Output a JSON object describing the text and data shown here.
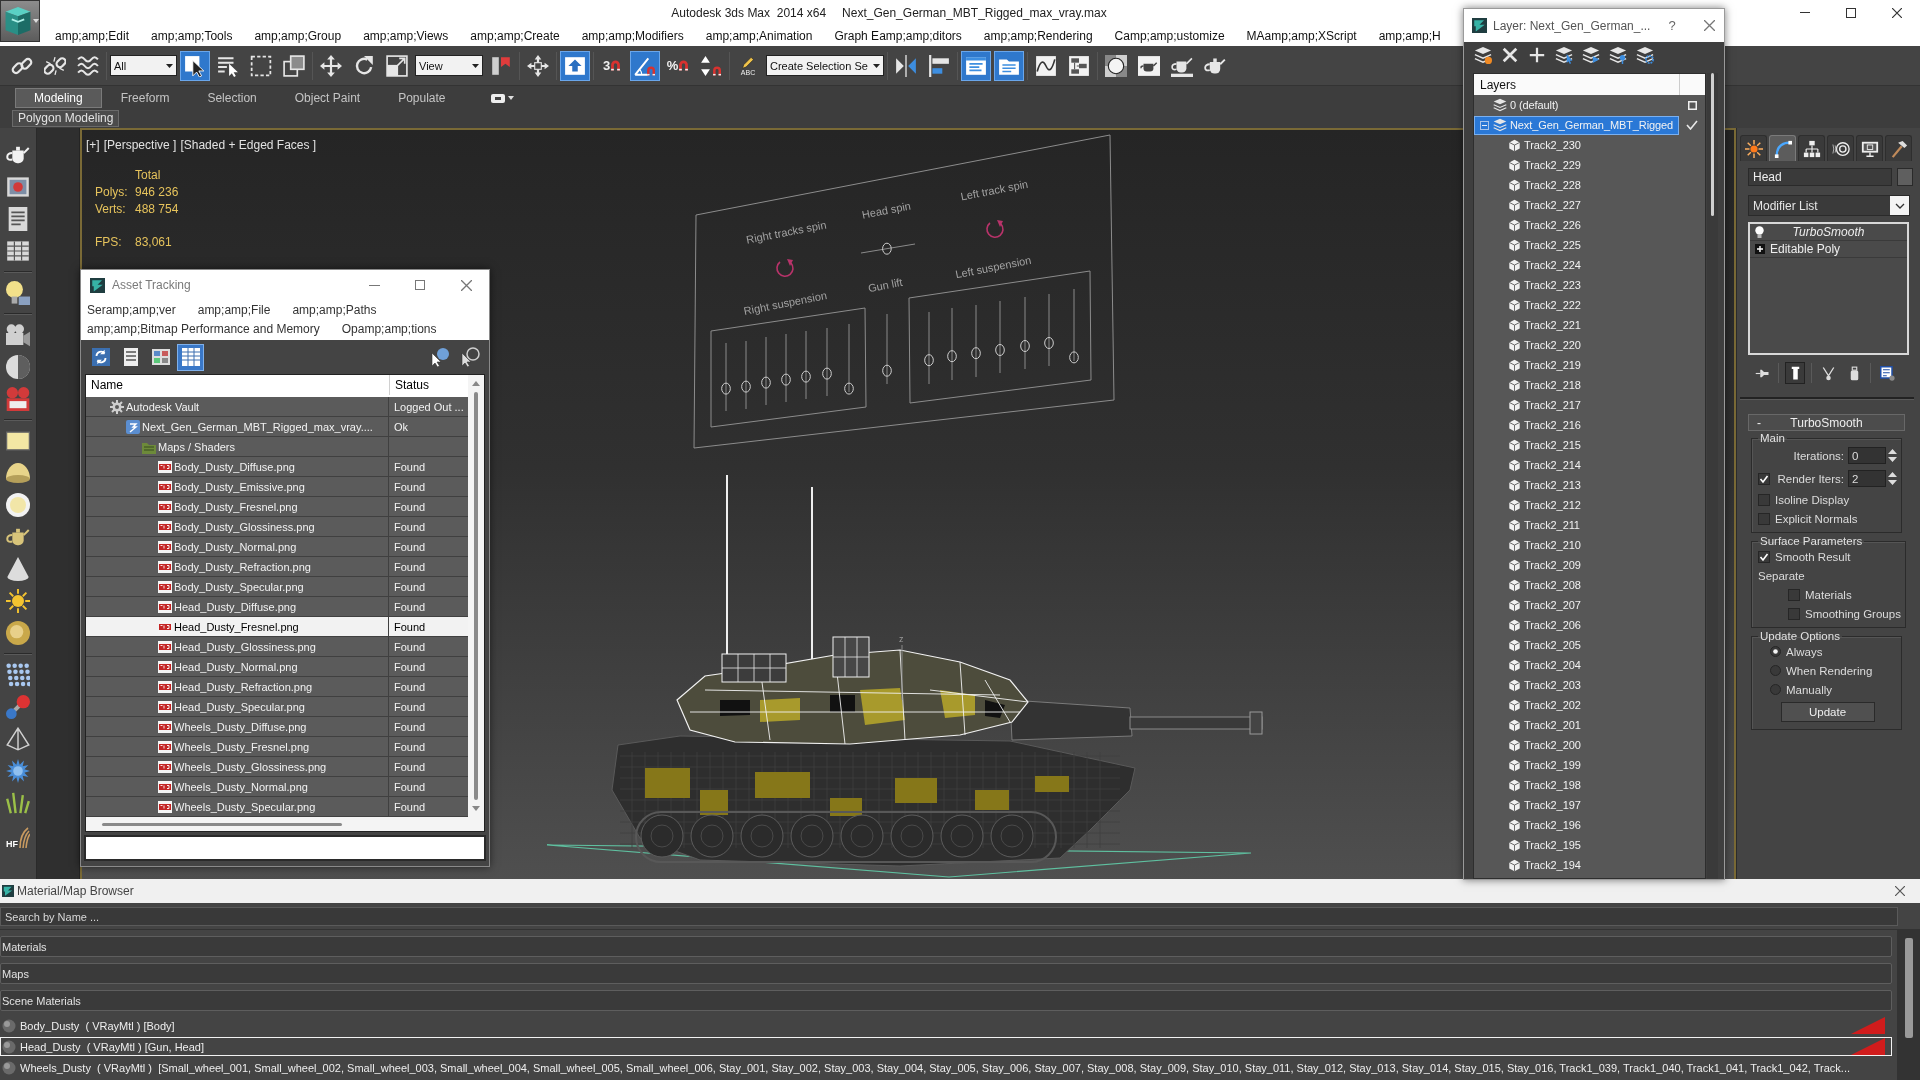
{
  "title_bar": {
    "app": "Autodesk 3ds Max  2014 x64",
    "file": "Next_Gen_German_MBT_Rigged_max_vray.max"
  },
  "menu": [
    "amp;amp;Edit",
    "amp;amp;Tools",
    "amp;amp;Group",
    "amp;amp;Views",
    "amp;amp;Create",
    "amp;amp;Modifiers",
    "amp;amp;Animation",
    "Graph Eamp;amp;ditors",
    "amp;amp;Rendering",
    "Camp;amp;ustomize",
    "MAamp;amp;XScript",
    "amp;amp;H"
  ],
  "toolbar": [
    [
      {
        "kind": "link",
        "on": false
      },
      {
        "kind": "unlink",
        "on": false
      },
      {
        "kind": "bind",
        "on": false
      }
    ],
    [
      {
        "kind": "filter-dropdown",
        "value": "All"
      },
      {
        "kind": "select",
        "on": true
      },
      {
        "kind": "select-by-name",
        "on": false
      },
      {
        "kind": "region",
        "on": false
      },
      {
        "kind": "crossing",
        "on": false
      }
    ],
    [
      {
        "kind": "move",
        "on": false
      },
      {
        "kind": "rotate",
        "on": false
      },
      {
        "kind": "scale",
        "on": false
      },
      {
        "kind": "coordinate-dropdown",
        "value": "View"
      },
      {
        "kind": "pivot",
        "on": false
      }
    ],
    [
      {
        "kind": "manipulate",
        "on": false
      }
    ],
    [
      {
        "kind": "keyboard",
        "on": true
      }
    ],
    [
      {
        "kind": "snap",
        "label": "3",
        "on": false
      },
      {
        "kind": "angle-snap",
        "on": true
      },
      {
        "kind": "percent-snap",
        "label": "%",
        "on": false
      },
      {
        "kind": "spinner-snap",
        "on": false
      }
    ],
    [
      {
        "kind": "named-selection",
        "label": "ABC",
        "on": false
      },
      {
        "kind": "selection-set-dropdown",
        "value": "Create Selection Se"
      }
    ],
    [
      {
        "kind": "mirror",
        "on": false
      },
      {
        "kind": "align",
        "on": false
      }
    ],
    [
      {
        "kind": "scene-explorer",
        "on": true
      },
      {
        "kind": "layer-manager",
        "on": true
      }
    ],
    [
      {
        "kind": "curve-editor",
        "on": false
      },
      {
        "kind": "schematic",
        "on": false
      }
    ],
    [
      {
        "kind": "material-editor",
        "on": false
      },
      {
        "kind": "render-setup",
        "on": false
      },
      {
        "kind": "frame-window",
        "on": false
      },
      {
        "kind": "render",
        "on": false
      }
    ]
  ],
  "ribbon": {
    "tabs": [
      {
        "label": "Modeling",
        "selected": true
      },
      {
        "label": "Freeform",
        "selected": false
      },
      {
        "label": "Selection",
        "selected": false
      },
      {
        "label": "Object Paint",
        "selected": false
      },
      {
        "label": "Populate",
        "selected": false
      }
    ],
    "panel": "Polygon Modeling"
  },
  "left_toolbar": {
    "hair_label": "HF"
  },
  "viewport": {
    "menus": [
      "[+]",
      "[Perspective ]",
      "[Shaded + Edged Faces ]"
    ],
    "stats_heading": "Total",
    "stats": [
      {
        "label": "Polys:",
        "value": "946 236"
      },
      {
        "label": "Verts:",
        "value": "488 754"
      }
    ],
    "fps": {
      "label": "FPS:",
      "value": "83,061"
    },
    "rig_labels": [
      "Right tracks spin",
      "Head spin",
      "Left track spin",
      "Right suspension",
      "Gun lift",
      "Left suspension"
    ],
    "rig_sliders": [
      {
        "level": 0.33
      },
      {
        "level": 0.33
      },
      {
        "level": 0.33
      },
      {
        "level": 0.33
      },
      {
        "level": 0.33
      },
      {
        "level": 0.33
      },
      {
        "level": 0.05
      },
      {
        "level": 0.33
      },
      {
        "level": 0.33
      },
      {
        "level": 0.33
      },
      {
        "level": 0.32
      },
      {
        "level": 0.32
      },
      {
        "level": 0.32
      },
      {
        "level": 0.05
      },
      {
        "level": 0.19
      },
      {
        "level": 0.48
      }
    ],
    "axis_label": "z"
  },
  "asset_tracking": {
    "title": "Asset Tracking",
    "menu_rows": [
      [
        "Seramp;amp;ver",
        "amp;amp;File",
        "amp;amp;Paths"
      ],
      [
        "amp;amp;Bitmap Performance and Memory",
        "Opamp;amp;tions"
      ]
    ],
    "toolbar": [
      {
        "kind": "refresh",
        "on": false
      },
      {
        "kind": "list",
        "on": false
      },
      {
        "kind": "thumbnails",
        "on": false
      },
      {
        "kind": "table",
        "on": true
      }
    ],
    "columns": [
      "Name",
      "Status"
    ],
    "tree": [
      {
        "kind": "vault",
        "name": "Autodesk Vault",
        "status": "Logged Out ...",
        "selected": false,
        "children": [
          {
            "kind": "max-file",
            "name": "Next_Gen_German_MBT_Rigged_max_vray....",
            "status": "Ok",
            "selected": false,
            "children": [
              {
                "kind": "folder",
                "name": "Maps / Shaders",
                "selected": false,
                "children": [
                  {
                    "kind": "png",
                    "name": "Body_Dusty_Diffuse.png",
                    "status": "Found",
                    "selected": false
                  },
                  {
                    "kind": "png",
                    "name": "Body_Dusty_Emissive.png",
                    "status": "Found",
                    "selected": false
                  },
                  {
                    "kind": "png",
                    "name": "Body_Dusty_Fresnel.png",
                    "status": "Found",
                    "selected": false
                  },
                  {
                    "kind": "png",
                    "name": "Body_Dusty_Glossiness.png",
                    "status": "Found",
                    "selected": false
                  },
                  {
                    "kind": "png",
                    "name": "Body_Dusty_Normal.png",
                    "status": "Found",
                    "selected": false
                  },
                  {
                    "kind": "png",
                    "name": "Body_Dusty_Refraction.png",
                    "status": "Found",
                    "selected": false
                  },
                  {
                    "kind": "png",
                    "name": "Body_Dusty_Specular.png",
                    "status": "Found",
                    "selected": false
                  },
                  {
                    "kind": "png",
                    "name": "Head_Dusty_Diffuse.png",
                    "status": "Found",
                    "selected": false
                  },
                  {
                    "kind": "png",
                    "name": "Head_Dusty_Fresnel.png",
                    "status": "Found",
                    "selected": true
                  },
                  {
                    "kind": "png",
                    "name": "Head_Dusty_Glossiness.png",
                    "status": "Found",
                    "selected": false
                  },
                  {
                    "kind": "png",
                    "name": "Head_Dusty_Normal.png",
                    "status": "Found",
                    "selected": false
                  },
                  {
                    "kind": "png",
                    "name": "Head_Dusty_Refraction.png",
                    "status": "Found",
                    "selected": false
                  },
                  {
                    "kind": "png",
                    "name": "Head_Dusty_Specular.png",
                    "status": "Found",
                    "selected": false
                  },
                  {
                    "kind": "png",
                    "name": "Wheels_Dusty_Diffuse.png",
                    "status": "Found",
                    "selected": false
                  },
                  {
                    "kind": "png",
                    "name": "Wheels_Dusty_Fresnel.png",
                    "status": "Found",
                    "selected": false
                  },
                  {
                    "kind": "png",
                    "name": "Wheels_Dusty_Glossiness.png",
                    "status": "Found",
                    "selected": false
                  },
                  {
                    "kind": "png",
                    "name": "Wheels_Dusty_Normal.png",
                    "status": "Found",
                    "selected": false
                  },
                  {
                    "kind": "png",
                    "name": "Wheels_Dusty_Specular.png",
                    "status": "Found",
                    "selected": false
                  }
                ]
              }
            ]
          }
        ]
      }
    ]
  },
  "layer_window": {
    "title": "Layer: Next_Gen_German_...",
    "help": "?",
    "header": "Layers",
    "layers": [
      {
        "name": "0 (default)",
        "current": false,
        "selected": false
      },
      {
        "name": "Next_Gen_German_MBT_Rigged",
        "current": true,
        "selected": true,
        "expanded": true,
        "children": [
          {
            "name": "Track2_230",
            "selected": false
          },
          {
            "name": "Track2_229",
            "selected": false
          },
          {
            "name": "Track2_228",
            "selected": false
          },
          {
            "name": "Track2_227",
            "selected": false
          },
          {
            "name": "Track2_226",
            "selected": false
          },
          {
            "name": "Track2_225",
            "selected": false
          },
          {
            "name": "Track2_224",
            "selected": false
          },
          {
            "name": "Track2_223",
            "selected": false
          },
          {
            "name": "Track2_222",
            "selected": false
          },
          {
            "name": "Track2_221",
            "selected": false
          },
          {
            "name": "Track2_220",
            "selected": false
          },
          {
            "name": "Track2_219",
            "selected": false
          },
          {
            "name": "Track2_218",
            "selected": false
          },
          {
            "name": "Track2_217",
            "selected": false
          },
          {
            "name": "Track2_216",
            "selected": false
          },
          {
            "name": "Track2_215",
            "selected": false
          },
          {
            "name": "Track2_214",
            "selected": false
          },
          {
            "name": "Track2_213",
            "selected": false
          },
          {
            "name": "Track2_212",
            "selected": false
          },
          {
            "name": "Track2_211",
            "selected": false
          },
          {
            "name": "Track2_210",
            "selected": false
          },
          {
            "name": "Track2_209",
            "selected": false
          },
          {
            "name": "Track2_208",
            "selected": false
          },
          {
            "name": "Track2_207",
            "selected": false
          },
          {
            "name": "Track2_206",
            "selected": false
          },
          {
            "name": "Track2_205",
            "selected": false
          },
          {
            "name": "Track2_204",
            "selected": false
          },
          {
            "name": "Track2_203",
            "selected": false
          },
          {
            "name": "Track2_202",
            "selected": false
          },
          {
            "name": "Track2_201",
            "selected": false
          },
          {
            "name": "Track2_200",
            "selected": false
          },
          {
            "name": "Track2_199",
            "selected": false
          },
          {
            "name": "Track2_198",
            "selected": false
          },
          {
            "name": "Track2_197",
            "selected": false
          },
          {
            "name": "Track2_196",
            "selected": false
          },
          {
            "name": "Track2_195",
            "selected": false
          },
          {
            "name": "Track2_194",
            "selected": false
          }
        ]
      }
    ]
  },
  "command_panel": {
    "tabs": [
      {
        "kind": "create",
        "selected": false
      },
      {
        "kind": "modify",
        "selected": true
      },
      {
        "kind": "hierarchy",
        "selected": false
      },
      {
        "kind": "motion",
        "selected": false
      },
      {
        "kind": "display",
        "selected": false
      },
      {
        "kind": "utilities",
        "selected": false
      }
    ],
    "object_name": "Head",
    "modifier_list": "Modifier List",
    "stack": [
      {
        "kind": "modifier",
        "name": "TurboSmooth",
        "on": true,
        "instanced": true
      },
      {
        "kind": "base-object",
        "name": "Editable Poly",
        "expanded": false,
        "instanced": false
      }
    ],
    "stack_buttons": [
      {
        "kind": "pin",
        "on": false
      },
      {
        "kind": "show-end-result",
        "on": true
      },
      {
        "kind": "make-unique",
        "on": false
      },
      {
        "kind": "remove",
        "on": false
      },
      {
        "kind": "configure",
        "on": false
      }
    ],
    "rollout": {
      "title": "TurboSmooth",
      "toggle": "-",
      "groups": [
        {
          "legend": "Main",
          "controls": [
            {
              "kind": "spinner",
              "label": "Iterations:",
              "value": "0"
            },
            {
              "kind": "check-spinner",
              "label": "Render Iters:",
              "checked": true,
              "value": "2"
            },
            {
              "kind": "checkbox",
              "label": "Isoline Display",
              "checked": false
            },
            {
              "kind": "checkbox",
              "label": "Explicit Normals",
              "checked": false
            }
          ]
        },
        {
          "legend": "Surface Parameters",
          "controls": [
            {
              "kind": "checkbox",
              "label": "Smooth Result",
              "checked": true
            },
            {
              "kind": "text",
              "label": "Separate"
            },
            {
              "kind": "sub-checkbox",
              "label": "Materials",
              "checked": false
            },
            {
              "kind": "sub-checkbox",
              "label": "Smoothing Groups",
              "checked": false
            }
          ]
        },
        {
          "legend": "Update Options",
          "controls": [
            {
              "kind": "radio",
              "label": "Always",
              "selected": true
            },
            {
              "kind": "radio",
              "label": "When Rendering",
              "selected": false
            },
            {
              "kind": "radio",
              "label": "Manually",
              "selected": false
            },
            {
              "kind": "button",
              "label": "Update"
            }
          ]
        }
      ]
    }
  },
  "material_browser": {
    "title": "Material/Map Browser",
    "search": {
      "placeholder": "Search by Name ..."
    },
    "groups": [
      {
        "label": "Materials"
      },
      {
        "label": "Maps"
      },
      {
        "label": "Scene Materials",
        "items": [
          {
            "name": "Body_Dusty  ( VRayMtl ) [Body]",
            "selected": false,
            "hot": true
          },
          {
            "name": "Head_Dusty  ( VRayMtl ) [Gun, Head]",
            "selected": true,
            "hot": true
          },
          {
            "name": "Wheels_Dusty  ( VRayMtl )  [Small_wheel_001, Small_wheel_002, Small_wheel_003, Small_wheel_004, Small_wheel_005, Small_wheel_006, Stay_001, Stay_002, Stay_003, Stay_004, Stay_005, Stay_006, Stay_007, Stay_008, Stay_009, Stay_010, Stay_011, Stay_012, Stay_013, Stay_014, Stay_015, Stay_016, Track1_039, Track1_040, Track1_041, Track1_042, Track...",
            "selected": false,
            "hot": false
          }
        ]
      }
    ]
  }
}
